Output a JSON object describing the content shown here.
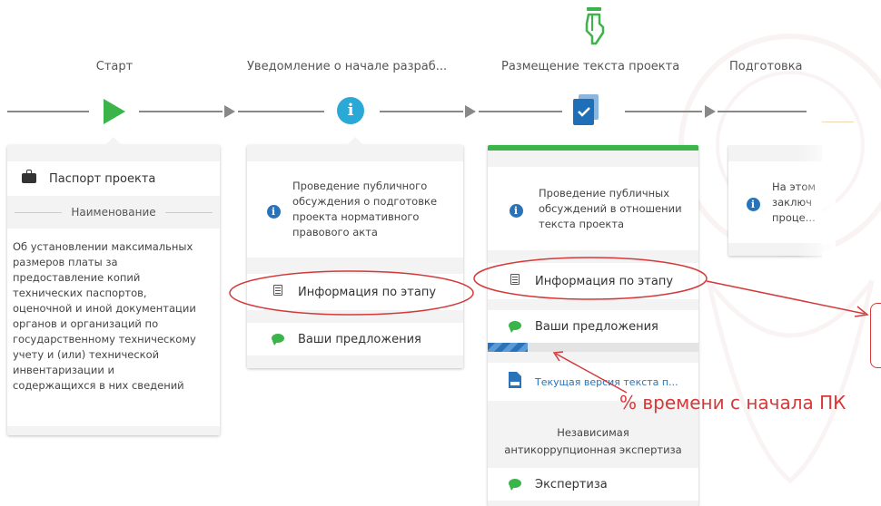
{
  "steps": [
    {
      "title": "Старт"
    },
    {
      "title": "Уведомление о начале разраб..."
    },
    {
      "title": "Размещение текста проекта"
    },
    {
      "title": "Подготовка"
    }
  ],
  "card1": {
    "passport_label": "Паспорт проекта",
    "name_heading": "Наименование",
    "description": "Об установлении максимальных размеров платы за предоставление копий технических паспортов, оценочной и иной документации органов и организаций по государственному техническому учету и (или) технической инвентаризации и содержащихся в них сведений"
  },
  "card2": {
    "info_text": "Проведение публичного обсуждения о подготовке проекта нормативного правового акта",
    "stage_info_label": "Информация по этапу",
    "proposals_label": "Ваши предложения"
  },
  "card3": {
    "info_text": "Проведение публичных обсуждений в отношении текста проекта",
    "stage_info_label": "Информация по этапу",
    "proposals_label": "Ваши предложения",
    "progress_percent": 19,
    "doc_label": "Текущая версия текста п...",
    "expertise_heading": "Независимая антикоррупционная экспертиза",
    "expertise_label": "Экспертиза",
    "accent_color": "#3bb44a"
  },
  "card4": {
    "info_text": "На этом заключ проце..."
  },
  "annotation": {
    "text": "% времени с начала ПК",
    "color": "#d43a3a"
  }
}
